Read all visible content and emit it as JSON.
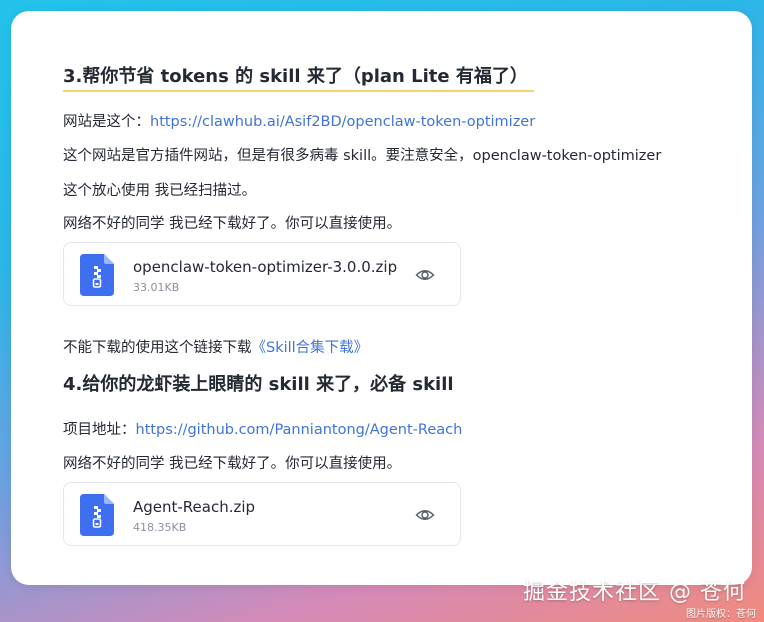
{
  "section3": {
    "heading": "3.帮你节省 tokens 的 skill 来了（plan Lite 有福了）",
    "site_label": "网站是这个：",
    "site_link": "https://clawhub.ai/Asif2BD/openclaw-token-optimizer",
    "line1": "这个网站是官方插件网站，但是有很多病毒 skill。要注意安全，openclaw-token-optimizer",
    "line2": "这个放心使用 我已经扫描过。",
    "line3": "网络不好的同学 我已经下载好了。你可以直接使用。",
    "file": {
      "name": "openclaw-token-optimizer-3.0.0.zip",
      "size": "33.01KB"
    },
    "alt_text": "不能下载的使用这个链接下载",
    "alt_link": "《Skill合集下载》"
  },
  "section4": {
    "heading": "4.给你的龙虾装上眼睛的 skill 来了，必备 skill",
    "project_label": "项目地址：",
    "project_link": "https://github.com/Panniantong/Agent-Reach",
    "line1": "网络不好的同学 我已经下载好了。你可以直接使用。",
    "file": {
      "name": "Agent-Reach.zip",
      "size": "418.35KB"
    }
  },
  "watermark": {
    "main": "掘金技术社区 @ 苍何",
    "sub": "图片版权：苍何"
  },
  "colors": {
    "link": "#3f74d9",
    "zip_icon": "#3e6ff0",
    "highlight": "#f5d36b"
  },
  "icons": {
    "file_icon": "zip-file-icon",
    "preview_icon": "eye-icon"
  }
}
